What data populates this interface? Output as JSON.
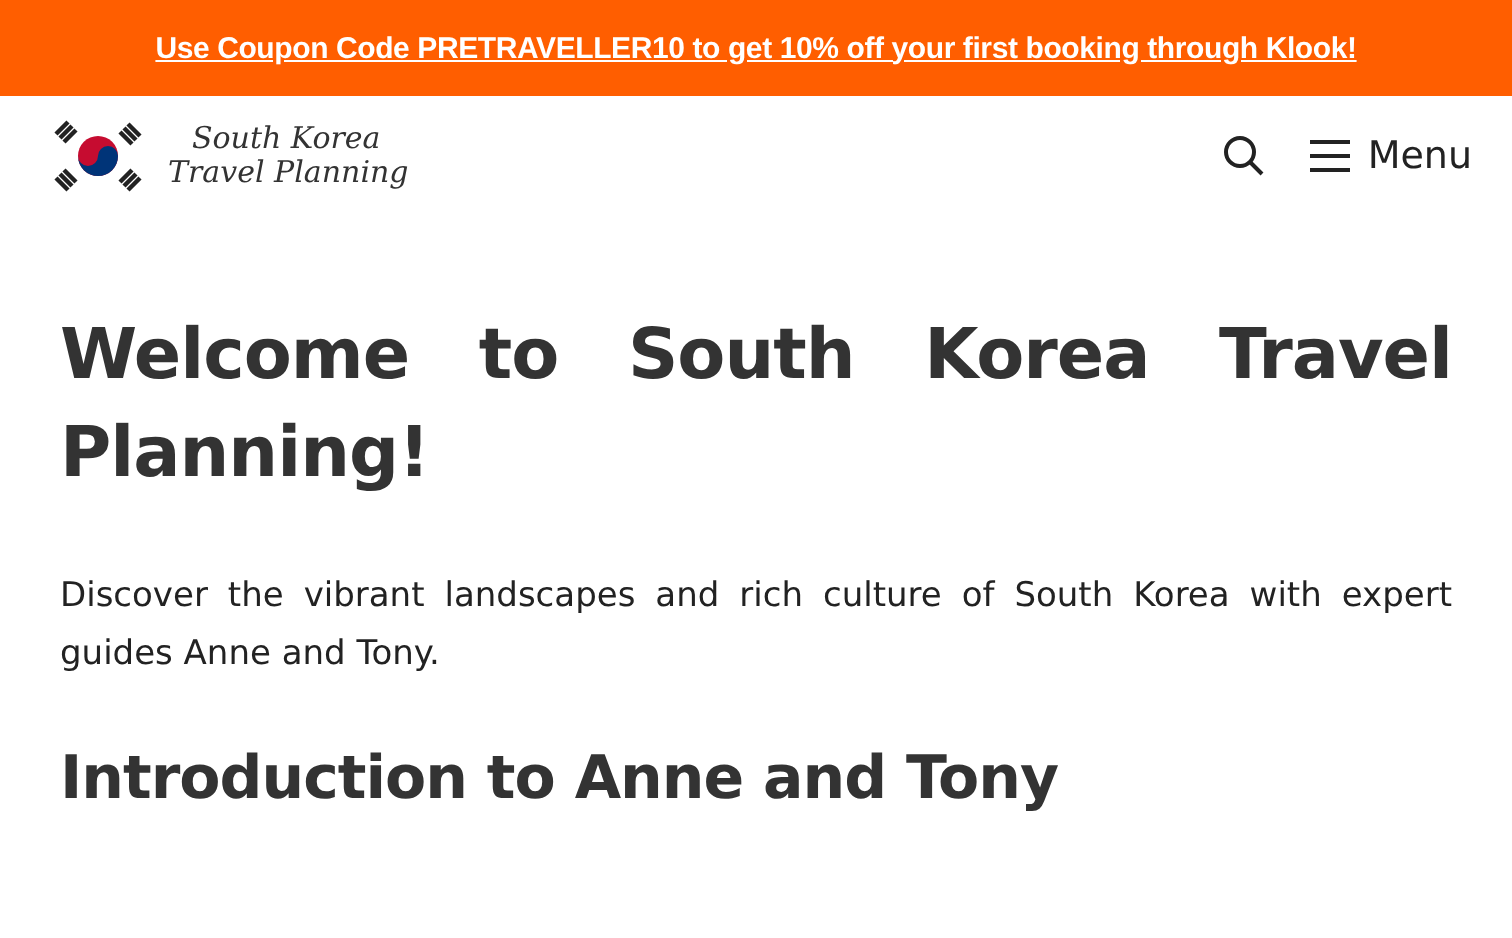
{
  "banner": {
    "text": "Use Coupon Code PRETRAVELLER10 to get 10% off your first booking through Klook!"
  },
  "header": {
    "logo_text": [
      "South Korea",
      "Travel Planning"
    ],
    "menu_label": "Menu"
  },
  "content": {
    "title": "Welcome to South Korea Travel Planning!",
    "intro": "Discover the vibrant landscapes and rich culture of South Korea with expert guides Anne and Tony.",
    "heading": "Introduction to Anne and Tony"
  }
}
